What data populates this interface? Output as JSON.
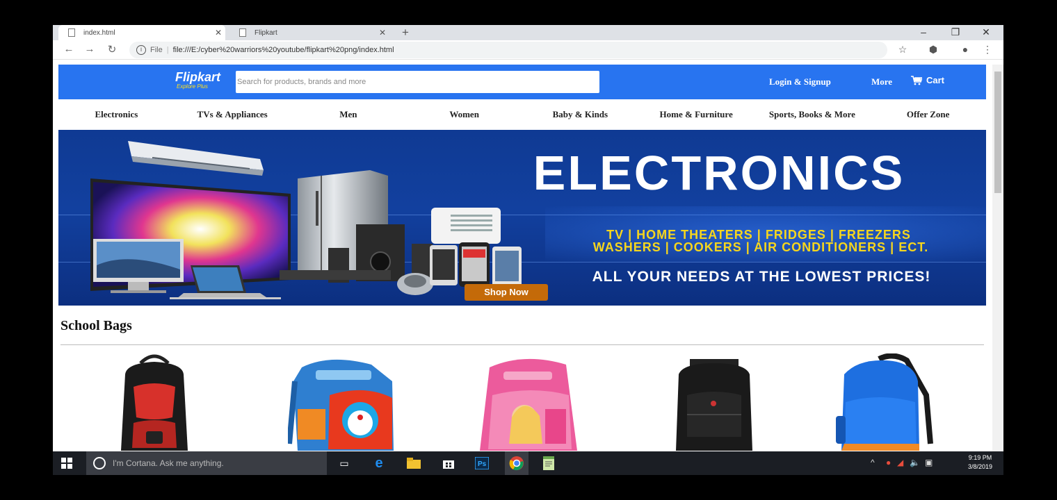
{
  "browser": {
    "tabs": [
      {
        "title": "index.html",
        "active": true
      },
      {
        "title": "Flipkart",
        "active": false
      }
    ],
    "url_prefix": "File",
    "url": "file:///E:/cyber%20warriors%20youtube/flipkart%20png/index.html"
  },
  "header": {
    "logo": "Flipkart",
    "logo_tagline": "Explore Plus",
    "search_placeholder": "Search for products, brands and more",
    "login": "Login & Signup",
    "more": "More",
    "cart": "Cart",
    "color": "#2874f0"
  },
  "nav": {
    "items": [
      "Electronics",
      "TVs & Appliances",
      "Men",
      "Women",
      "Baby & Kinds",
      "Home & Furniture",
      "Sports, Books & More",
      "Offer Zone"
    ]
  },
  "banner": {
    "title": "ELECTRONICS",
    "line1": "TV | HOME THEATERS | FRIDGES | FREEZERS",
    "line2": "WASHERS | COOKERS | AIR CONDITIONERS | ECT.",
    "tagline": "ALL YOUR NEEDS AT THE LOWEST PRICES!",
    "cta": "Shop Now"
  },
  "section": {
    "title": "School Bags"
  },
  "taskbar": {
    "search_placeholder": "I'm Cortana. Ask me anything.",
    "time": "9:19 PM",
    "date": "3/8/2019"
  }
}
